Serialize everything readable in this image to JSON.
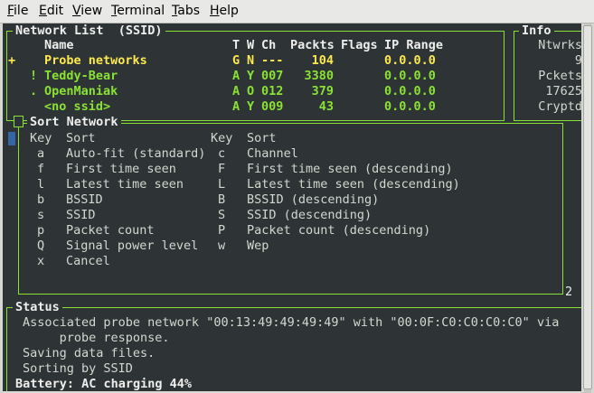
{
  "menu": [
    "File",
    "Edit",
    "View",
    "Terminal",
    "Tabs",
    "Help"
  ],
  "network_panel": {
    "title": "Network List  (SSID)",
    "headers": {
      "name": "Name",
      "t": "T",
      "w": "W",
      "ch": "Ch",
      "packets": "Packts",
      "flags": "Flags",
      "ip": "IP Range"
    },
    "rows": [
      {
        "flag": "+",
        "name": "Probe networks",
        "t": "G",
        "w": "N",
        "ch": "---",
        "packets": "104",
        "flags": "",
        "ip": "0.0.0.0"
      },
      {
        "flag": "!",
        "name": "Teddy-Bear",
        "t": "A",
        "w": "Y",
        "ch": "007",
        "packets": "3380",
        "flags": "",
        "ip": "0.0.0.0"
      },
      {
        "flag": ".",
        "name": "OpenManiak",
        "t": "A",
        "w": "O",
        "ch": "012",
        "packets": "379",
        "flags": "",
        "ip": "0.0.0.0"
      },
      {
        "flag": "",
        "name": "<no ssid>",
        "t": "A",
        "w": "Y",
        "ch": "009",
        "packets": "43",
        "flags": "",
        "ip": "0.0.0.0"
      }
    ]
  },
  "info_panel": {
    "title": "Info",
    "rows": [
      "Ntwrks",
      "9",
      "Pckets",
      "17625",
      "Cryptd"
    ]
  },
  "sort_panel": {
    "title": "Sort Network",
    "header": {
      "key": "Key",
      "sort": "Sort"
    },
    "left": [
      {
        "key": "a",
        "desc": "Auto-fit (standard)"
      },
      {
        "key": "f",
        "desc": "First time seen"
      },
      {
        "key": "l",
        "desc": "Latest time seen"
      },
      {
        "key": "b",
        "desc": "BSSID"
      },
      {
        "key": "s",
        "desc": "SSID"
      },
      {
        "key": "p",
        "desc": "Packet count"
      },
      {
        "key": "Q",
        "desc": "Signal power level"
      },
      {
        "key": "x",
        "desc": "Cancel"
      }
    ],
    "right": [
      {
        "key": "c",
        "desc": "Channel"
      },
      {
        "key": "F",
        "desc": "First time seen (descending)"
      },
      {
        "key": "L",
        "desc": "Latest time seen (descending)"
      },
      {
        "key": "B",
        "desc": "BSSID (descending)"
      },
      {
        "key": "S",
        "desc": "SSID (descending)"
      },
      {
        "key": "P",
        "desc": "Packet count (descending)"
      },
      {
        "key": "w",
        "desc": "Wep"
      }
    ]
  },
  "page_marker": "2",
  "status_panel": {
    "title": "Status",
    "lines": [
      "Associated probe network \"00:13:49:49:49:49\" with \"00:0F:C0:C0:C0:C0\" via",
      "     probe response.",
      "Saving data files.",
      "Sorting by SSID"
    ],
    "battery": "Battery: AC charging 44%"
  },
  "colors": {
    "terminal_bg": "#2e3436",
    "frame_green": "#8ae234",
    "highlight_yellow": "#fce94f",
    "text": "#d3d7cf",
    "cursor": "#3465a4"
  }
}
